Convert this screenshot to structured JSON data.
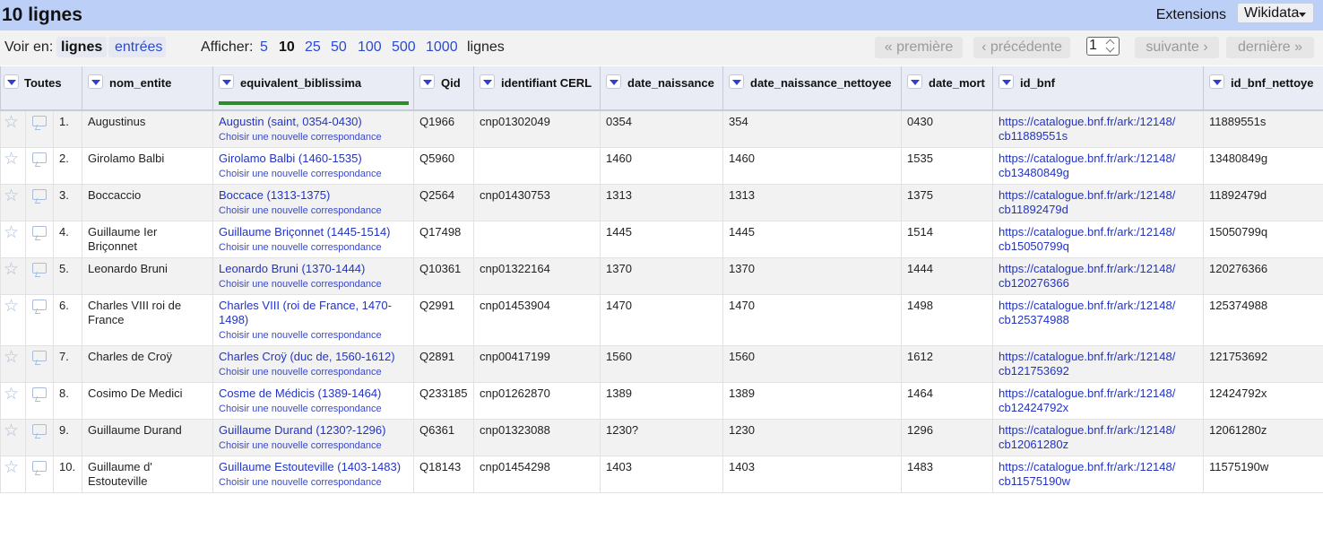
{
  "header": {
    "title": "10 lignes",
    "extensions_label": "Extensions",
    "wikidata_label": "Wikidata"
  },
  "toolbar": {
    "voir_en": "Voir en:",
    "lignes": "lignes",
    "entrees": "entrées",
    "afficher": "Afficher:",
    "sizes": [
      "5",
      "10",
      "25",
      "50",
      "100",
      "500",
      "1000"
    ],
    "sizes_suffix": "lignes",
    "premiere": "« première",
    "precedente": "‹ précédente",
    "page": "1",
    "suivante": "suivante ›",
    "derniere": "dernière »"
  },
  "columns": {
    "toutes": "Toutes",
    "nom_entite": "nom_entite",
    "equivalent_biblissima": "equivalent_biblissima",
    "qid": "Qid",
    "cerl": "identifiant CERL",
    "date_naissance": "date_naissance",
    "date_naissance_nettoyee": "date_naissance_nettoyee",
    "date_mort": "date_mort",
    "id_bnf": "id_bnf",
    "id_bnf_nettoyee": "id_bnf_nettoye"
  },
  "sub_label": "Choisir une nouvelle correspondance",
  "rows": [
    {
      "n": "1.",
      "nom": "Augustinus",
      "equiv": "Augustin (saint, 0354-0430)",
      "qid": "Q1966",
      "cerl": "cnp01302049",
      "dn": "0354",
      "dnn": "354",
      "dm": "0430",
      "bnf1": "https://catalogue.bnf.fr/ark:/12148/",
      "bnf2": "cb11889551s",
      "bnfn": "11889551s"
    },
    {
      "n": "2.",
      "nom": "Girolamo Balbi",
      "equiv": "Girolamo Balbi (1460-1535)",
      "qid": "Q5960",
      "cerl": "",
      "dn": "1460",
      "dnn": "1460",
      "dm": "1535",
      "bnf1": "https://catalogue.bnf.fr/ark:/12148/",
      "bnf2": "cb13480849g",
      "bnfn": "13480849g"
    },
    {
      "n": "3.",
      "nom": "Boccaccio",
      "equiv": "Boccace (1313-1375)",
      "qid": "Q2564",
      "cerl": "cnp01430753",
      "dn": "1313",
      "dnn": "1313",
      "dm": "1375",
      "bnf1": "https://catalogue.bnf.fr/ark:/12148/",
      "bnf2": "cb11892479d",
      "bnfn": "11892479d"
    },
    {
      "n": "4.",
      "nom": "Guillaume Ier Briçonnet",
      "equiv": "Guillaume Briçonnet (1445-1514)",
      "qid": "Q17498",
      "cerl": "",
      "dn": "1445",
      "dnn": "1445",
      "dm": "1514",
      "bnf1": "https://catalogue.bnf.fr/ark:/12148/",
      "bnf2": "cb15050799q",
      "bnfn": "15050799q"
    },
    {
      "n": "5.",
      "nom": "Leonardo Bruni",
      "equiv": "Leonardo Bruni (1370-1444)",
      "qid": "Q10361",
      "cerl": "cnp01322164",
      "dn": "1370",
      "dnn": "1370",
      "dm": "1444",
      "bnf1": "https://catalogue.bnf.fr/ark:/12148/",
      "bnf2": "cb120276366",
      "bnfn": "120276366"
    },
    {
      "n": "6.",
      "nom": "Charles VIII roi de France",
      "equiv": "Charles VIII (roi de France, 1470-1498)",
      "qid": "Q2991",
      "cerl": "cnp01453904",
      "dn": "1470",
      "dnn": "1470",
      "dm": "1498",
      "bnf1": "https://catalogue.bnf.fr/ark:/12148/",
      "bnf2": "cb125374988",
      "bnfn": "125374988"
    },
    {
      "n": "7.",
      "nom": "Charles de Croÿ",
      "equiv": "Charles Croÿ (duc de, 1560-1612)",
      "qid": "Q2891",
      "cerl": "cnp00417199",
      "dn": "1560",
      "dnn": "1560",
      "dm": "1612",
      "bnf1": "https://catalogue.bnf.fr/ark:/12148/",
      "bnf2": "cb121753692",
      "bnfn": "121753692"
    },
    {
      "n": "8.",
      "nom": "Cosimo De Medici",
      "equiv": "Cosme de Médicis (1389-1464)",
      "qid": "Q233185",
      "cerl": "cnp01262870",
      "dn": "1389",
      "dnn": "1389",
      "dm": "1464",
      "bnf1": "https://catalogue.bnf.fr/ark:/12148/",
      "bnf2": "cb12424792x",
      "bnfn": "12424792x"
    },
    {
      "n": "9.",
      "nom": "Guillaume Durand",
      "equiv": "Guillaume Durand (1230?-1296)",
      "qid": "Q6361",
      "cerl": "cnp01323088",
      "dn": "1230?",
      "dnn": "1230",
      "dm": "1296",
      "bnf1": "https://catalogue.bnf.fr/ark:/12148/",
      "bnf2": "cb12061280z",
      "bnfn": "12061280z"
    },
    {
      "n": "10.",
      "nom": "Guillaume d' Estouteville",
      "equiv": "Guillaume Estouteville (1403-1483)",
      "qid": "Q18143",
      "cerl": "cnp01454298",
      "dn": "1403",
      "dnn": "1403",
      "dm": "1483",
      "bnf1": "https://catalogue.bnf.fr/ark:/12148/",
      "bnf2": "cb11575190w",
      "bnfn": "11575190w"
    }
  ]
}
